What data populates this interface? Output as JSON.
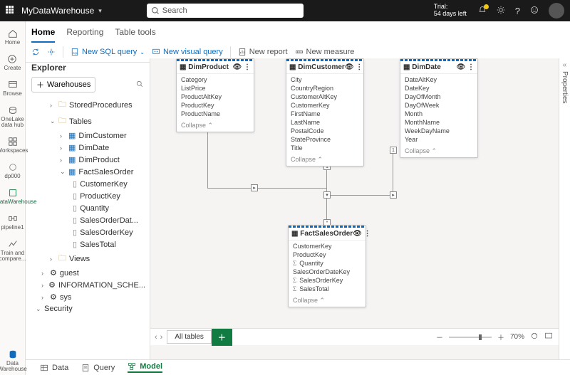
{
  "topbar": {
    "workspace": "MyDataWarehouse",
    "search_placeholder": "Search",
    "trial_label": "Trial:",
    "trial_days": "54 days left"
  },
  "ribbon": {
    "tabs": [
      "Home",
      "Reporting",
      "Table tools"
    ],
    "active_tab": "Home",
    "cmds": {
      "new_sql": "New SQL query",
      "new_visual": "New visual query",
      "new_report": "New report",
      "new_measure": "New measure"
    }
  },
  "leftnav": {
    "items": [
      "Home",
      "Create",
      "Browse",
      "OneLake data hub",
      "Workspaces",
      "dp000",
      "MyDataWarehouse",
      "pipeline1",
      "Train and compare..."
    ],
    "footer": "Data Warehouse"
  },
  "explorer": {
    "title": "Explorer",
    "warehouses_btn": "Warehouses",
    "tree": {
      "stored_procs": "StoredProcedures",
      "tables": "Tables",
      "table_items": [
        "DimCustomer",
        "DimDate",
        "DimProduct",
        "FactSalesOrder"
      ],
      "fact_columns": [
        "CustomerKey",
        "ProductKey",
        "Quantity",
        "SalesOrderDat...",
        "SalesOrderKey",
        "SalesTotal"
      ],
      "views": "Views",
      "schemas": [
        "guest",
        "INFORMATION_SCHE...",
        "sys"
      ],
      "security": "Security"
    }
  },
  "canvas": {
    "collapse": "Collapse",
    "cards": {
      "DimProduct": {
        "title": "DimProduct",
        "fields": [
          "Category",
          "ListPrice",
          "ProductAltKey",
          "ProductKey",
          "ProductName"
        ]
      },
      "DimCustomer": {
        "title": "DimCustomer",
        "fields": [
          "City",
          "CountryRegion",
          "CustomerAltKey",
          "CustomerKey",
          "FirstName",
          "LastName",
          "PostalCode",
          "StateProvince",
          "Title"
        ]
      },
      "DimDate": {
        "title": "DimDate",
        "fields": [
          "DateAltKey",
          "DateKey",
          "DayOfMonth",
          "DayOfWeek",
          "Month",
          "MonthName",
          "WeekDayName",
          "Year"
        ]
      },
      "FactSalesOrder": {
        "title": "FactSalesOrder",
        "fields": [
          {
            "n": "CustomerKey",
            "agg": false
          },
          {
            "n": "ProductKey",
            "agg": false
          },
          {
            "n": "Quantity",
            "agg": true
          },
          {
            "n": "SalesOrderDateKey",
            "agg": false
          },
          {
            "n": "SalesOrderKey",
            "agg": true
          },
          {
            "n": "SalesTotal",
            "agg": true
          }
        ]
      }
    }
  },
  "bottom": {
    "all_tables": "All tables",
    "zoom": "70%"
  },
  "views": {
    "data": "Data",
    "query": "Query",
    "model": "Model"
  },
  "props": "Properties"
}
